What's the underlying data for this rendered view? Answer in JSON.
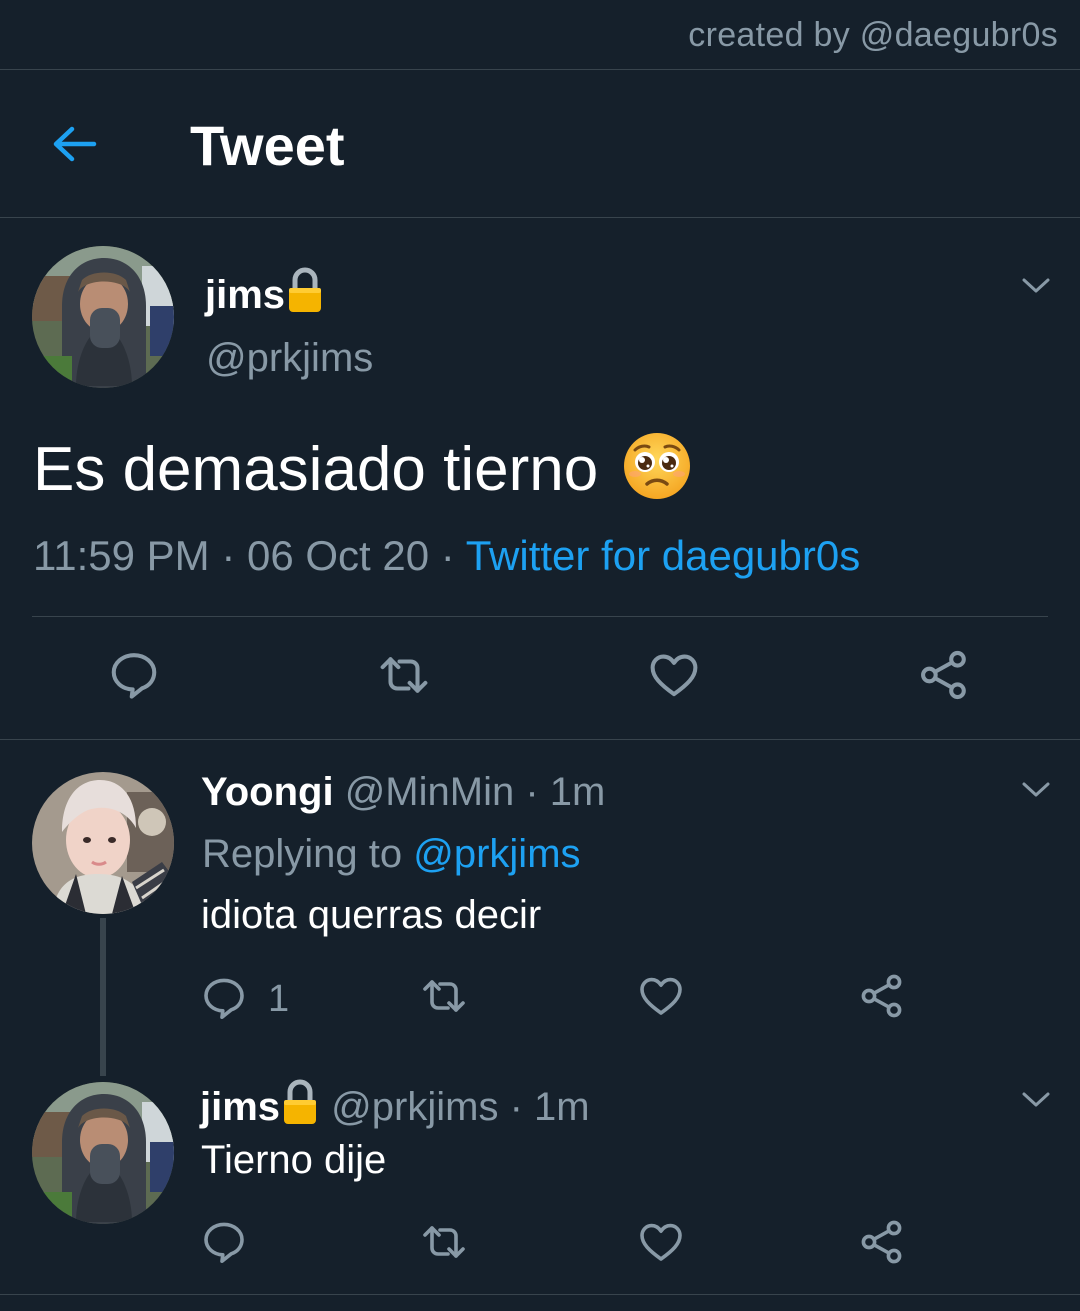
{
  "credit": "created by @daegubr0s",
  "header": {
    "title": "Tweet"
  },
  "main_tweet": {
    "display_name": "jims",
    "handle": "@prkjims",
    "text": "Es demasiado tierno",
    "time": "11:59 PM",
    "date": "06 Oct 20",
    "separator": "·",
    "source": "Twitter for daegubr0s"
  },
  "replies": [
    {
      "display_name": "Yoongi",
      "handle": "@MinMin",
      "time": "1m",
      "separator": "·",
      "replying_label": "Replying to",
      "replying_to": "@prkjims",
      "text": "idiota querras decir",
      "reply_count": "1"
    },
    {
      "display_name": "jims",
      "handle": "@prkjims",
      "time": "1m",
      "separator": "·",
      "text": "Tierno dije"
    }
  ],
  "colors": {
    "background": "#15202b",
    "accent": "#1da1f2",
    "muted": "#8899a6",
    "divider": "#38444d",
    "lock": "#f5b400"
  },
  "icons": [
    "back-arrow-icon",
    "chevron-down-icon",
    "reply-icon",
    "retweet-icon",
    "like-icon",
    "share-icon",
    "lock-icon",
    "pleading-face-icon"
  ]
}
